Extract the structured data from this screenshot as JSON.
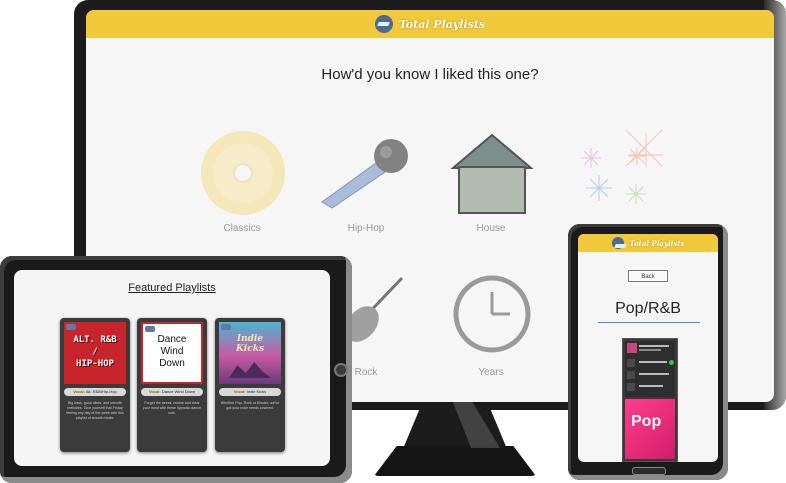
{
  "app": {
    "brand": "Total Playlists",
    "brand_color": "#f2c93b"
  },
  "desktop": {
    "question": "How'd you know I liked this one?",
    "genres": [
      {
        "label": "Classics",
        "icon": "cd-icon"
      },
      {
        "label": "Hip-Hop",
        "icon": "microphone-icon"
      },
      {
        "label": "House",
        "icon": "house-icon"
      },
      {
        "label": "",
        "icon": "fireworks-icon"
      },
      {
        "label": "Rock",
        "icon": "guitar-icon"
      },
      {
        "label": "Years",
        "icon": "clock-icon"
      }
    ]
  },
  "tablet": {
    "title": "Featured Playlists",
    "cards": [
      {
        "cover_lines": [
          "ALT. R&B",
          "/",
          "HIP-HOP"
        ],
        "pill_key": "Vocal:",
        "pill_value": "Alt. R&B/Hip-Hop",
        "desc": "Big bass, good vibes, and smooth melodies. Give yourself that Friday feeling any day of the week with this playlist of smooth beats."
      },
      {
        "cover_lines": [
          "Dance",
          "Wind",
          "Down"
        ],
        "pill_key": "Vocal:",
        "pill_value": "Dance Wind Down",
        "desc": "Forget the stress, recline and clear your mind with these hypnotic dance cuts."
      },
      {
        "cover_lines": [
          "Indie",
          "Kicks"
        ],
        "pill_key": "Vocal:",
        "pill_value": "Indie Kicks",
        "desc": "Whether Pop, Rock or Electro, we've got your indie needs covered."
      }
    ]
  },
  "phone": {
    "back_label": "Back",
    "title": "Pop/R&B",
    "thumb_label": "Pop"
  }
}
